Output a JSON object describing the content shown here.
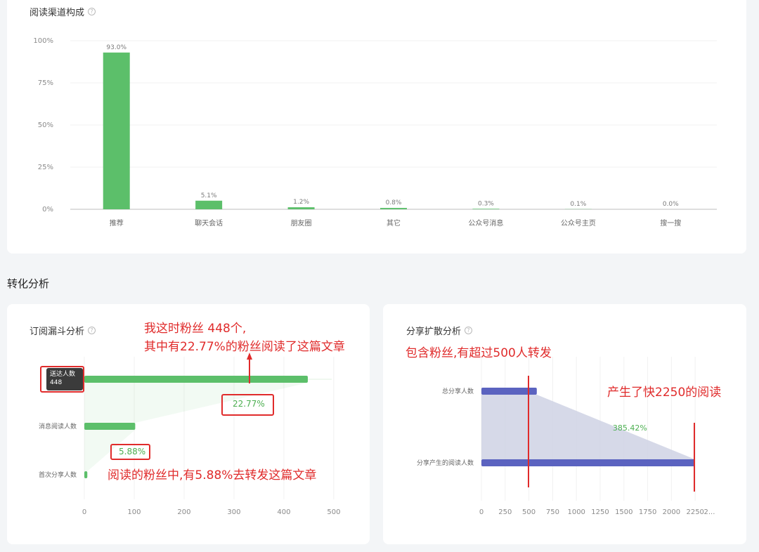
{
  "reading_channels": {
    "title": "阅读渠道构成",
    "help_icon": "question-circle-icon",
    "accent": "#5cbf6a"
  },
  "section": {
    "title": "转化分析"
  },
  "subscription_funnel": {
    "title": "订阅漏斗分析",
    "tooltip": {
      "label": "送达人数",
      "value": "448"
    }
  },
  "share_diffusion": {
    "title": "分享扩散分析"
  },
  "annotations": {
    "funnel_top_line1": "我这时粉丝 448个,",
    "funnel_top_line2": "其中有22.77%的粉丝阅读了这篇文章",
    "funnel_box1": "22.77%",
    "funnel_box2": "5.88%",
    "funnel_bottom": "阅读的粉丝中,有5.88%去转发这篇文章",
    "share_left": "包含粉丝,有超过500人转发",
    "share_right": "产生了快2250的阅读",
    "color": "#e02b2b"
  },
  "chart_data": [
    {
      "id": "reading-channels",
      "type": "bar",
      "categories": [
        "推荐",
        "聊天会话",
        "朋友圈",
        "其它",
        "公众号消息",
        "公众号主页",
        "搜一搜"
      ],
      "values": [
        93.0,
        5.1,
        1.2,
        0.8,
        0.3,
        0.1,
        0.0
      ],
      "value_labels": [
        "93.0%",
        "5.1%",
        "1.2%",
        "0.8%",
        "0.3%",
        "0.1%",
        "0.0%"
      ],
      "ylim": [
        0,
        100
      ],
      "ytick_labels": [
        "0%",
        "25%",
        "50%",
        "75%",
        "100%"
      ],
      "ytick_values": [
        0,
        25,
        50,
        75,
        100
      ],
      "color": "#5cbf6a",
      "grid": true
    },
    {
      "id": "subscription-funnel",
      "type": "bar",
      "orientation": "horizontal",
      "categories": [
        "送达人数",
        "消息阅读人数",
        "首次分享人数"
      ],
      "values": [
        448,
        102,
        6
      ],
      "conversion_labels": [
        "22.77%",
        "5.88%"
      ],
      "xlim": [
        0,
        510
      ],
      "xtick_values": [
        0,
        100,
        200,
        300,
        400,
        500
      ],
      "xtick_labels": [
        "0",
        "100",
        "200",
        "300",
        "400",
        "500"
      ],
      "color": "#5cbf6a",
      "grid": true
    },
    {
      "id": "share-diffusion",
      "type": "bar",
      "orientation": "horizontal",
      "categories": [
        "总分享人数",
        "分享产生的阅读人数"
      ],
      "values": [
        583,
        2247
      ],
      "conversion_label": "385.42%",
      "xlim": [
        0,
        2500
      ],
      "xtick_values": [
        0,
        250,
        500,
        750,
        1000,
        1250,
        1500,
        1750,
        2000,
        2250
      ],
      "xtick_labels": [
        "0",
        "250",
        "500",
        "750",
        "1000",
        "1250",
        "1500",
        "1750",
        "2000",
        "2250",
        "2..."
      ],
      "color": "#5b63c0",
      "grid": true
    }
  ]
}
